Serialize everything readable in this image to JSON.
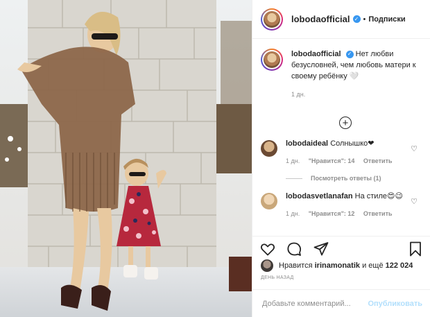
{
  "header": {
    "username": "lobodaofficial",
    "separator": "•",
    "follow_label": "Подписки"
  },
  "caption": {
    "username": "lobodaofficial",
    "text": "Нет любви безусловней, чем любовь матери к своему ребёнку 🤍",
    "time": "1 дн."
  },
  "comments": [
    {
      "username": "lobodaideal",
      "text": "Солнышко❤",
      "time": "1 дн.",
      "likes": "\"Нравится\": 14",
      "reply": "Ответить",
      "view_replies": "Посмотреть ответы (1)"
    },
    {
      "username": "lobodasvetlanafan",
      "text": "На стиле😍😉",
      "time": "1 дн.",
      "likes": "\"Нравится\": 12",
      "reply": "Ответить"
    }
  ],
  "likes": {
    "prefix": "Нравится",
    "user": "irinamonatik",
    "conj": "и ещё",
    "count": "122 024"
  },
  "date_label": "день назад",
  "add_comment": {
    "placeholder": "Добавьте комментарий...",
    "publish_label": "Опубликовать"
  },
  "icons": {
    "like": "heart-icon",
    "comment": "comment-icon",
    "share": "share-icon",
    "save": "bookmark-icon",
    "more": "plus-circle-icon",
    "verified": "verified-badge-icon"
  },
  "colors": {
    "verified": "#3897f0",
    "muted": "#8e8e8e",
    "publish": "#b2dffc"
  }
}
